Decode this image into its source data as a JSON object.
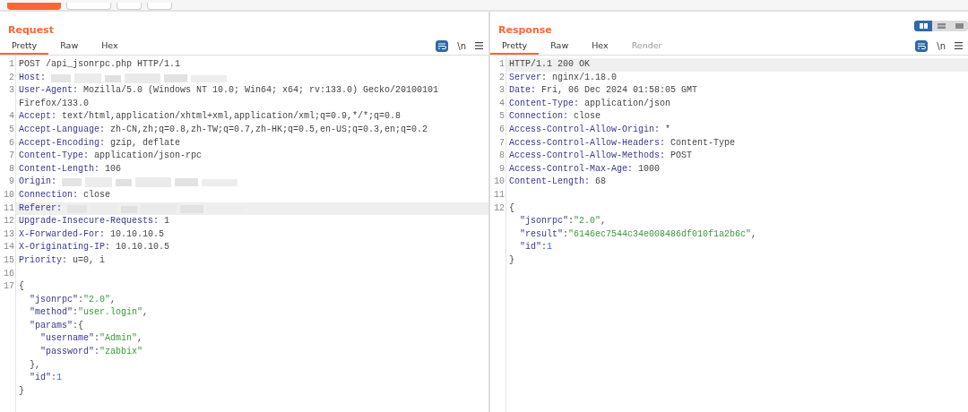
{
  "toolbar": {
    "buttons": [
      {
        "kind": "primary"
      },
      {
        "kind": "plain"
      },
      {
        "kind": "plain"
      },
      {
        "kind": "plain"
      }
    ]
  },
  "panes": [
    {
      "title": "Request",
      "tabs": [
        {
          "label": "Pretty",
          "selected": true,
          "disabled": false
        },
        {
          "label": "Raw",
          "selected": false,
          "disabled": false
        },
        {
          "label": "Hex",
          "selected": false,
          "disabled": false
        }
      ],
      "tools": {
        "wrap_on": true,
        "newline_label": "\\n"
      },
      "lines": [
        {
          "number": "1",
          "highlighted": false,
          "segments": [
            {
              "kind": "plain",
              "text": "POST /api_jsonrpc.php HTTP/1.1"
            }
          ]
        },
        {
          "number": "2",
          "highlighted": false,
          "segments": [
            {
              "kind": "key",
              "text": "Host:"
            },
            {
              "kind": "redacted"
            }
          ]
        },
        {
          "number": "3",
          "highlighted": false,
          "segments": [
            {
              "kind": "key",
              "text": "User-Agent:"
            },
            {
              "kind": "value",
              "text": "Mozilla/5.0 (Windows NT 10.0; Win64; x64; rv:133.0) Gecko/20100101 Firefox/133.0"
            }
          ]
        },
        {
          "number": "4",
          "highlighted": false,
          "segments": [
            {
              "kind": "key",
              "text": "Accept:"
            },
            {
              "kind": "value",
              "text": "text/html,application/xhtml+xml,application/xml;q=0.9,*/*;q=0.8"
            }
          ]
        },
        {
          "number": "5",
          "highlighted": false,
          "segments": [
            {
              "kind": "key",
              "text": "Accept-Language:"
            },
            {
              "kind": "value",
              "text": "zh-CN,zh;q=0.8,zh-TW;q=0.7,zh-HK;q=0.5,en-US;q=0.3,en;q=0.2"
            }
          ]
        },
        {
          "number": "6",
          "highlighted": false,
          "segments": [
            {
              "kind": "key",
              "text": "Accept-Encoding:"
            },
            {
              "kind": "value",
              "text": "gzip, deflate"
            }
          ]
        },
        {
          "number": "7",
          "highlighted": false,
          "segments": [
            {
              "kind": "key",
              "text": "Content-Type:"
            },
            {
              "kind": "value",
              "text": "application/json-rpc"
            }
          ]
        },
        {
          "number": "8",
          "highlighted": false,
          "segments": [
            {
              "kind": "key",
              "text": "Content-Length:"
            },
            {
              "kind": "value",
              "text": "106"
            }
          ]
        },
        {
          "number": "9",
          "highlighted": false,
          "segments": [
            {
              "kind": "key",
              "text": "Origin:"
            },
            {
              "kind": "redacted"
            }
          ]
        },
        {
          "number": "10",
          "highlighted": false,
          "segments": [
            {
              "kind": "key",
              "text": "Connection:"
            },
            {
              "kind": "value",
              "text": "close"
            }
          ]
        },
        {
          "number": "11",
          "highlighted": true,
          "segments": [
            {
              "kind": "key",
              "text": "Referer:"
            },
            {
              "kind": "redacted"
            }
          ]
        },
        {
          "number": "12",
          "highlighted": false,
          "segments": [
            {
              "kind": "key",
              "text": "Upgrade-Insecure-Requests:"
            },
            {
              "kind": "value",
              "text": "1"
            }
          ]
        },
        {
          "number": "13",
          "highlighted": false,
          "segments": [
            {
              "kind": "key",
              "text": "X-Forwarded-For:"
            },
            {
              "kind": "value",
              "text": "10.10.10.5"
            }
          ]
        },
        {
          "number": "14",
          "highlighted": false,
          "segments": [
            {
              "kind": "key",
              "text": "X-Originating-IP:"
            },
            {
              "kind": "value",
              "text": "10.10.10.5"
            }
          ]
        },
        {
          "number": "15",
          "highlighted": false,
          "segments": [
            {
              "kind": "key",
              "text": "Priority:"
            },
            {
              "kind": "value",
              "text": "u=0, i"
            }
          ]
        },
        {
          "number": "16",
          "highlighted": false
        },
        {
          "number": "17",
          "highlighted": false,
          "segments": [
            {
              "kind": "punct",
              "text": "{"
            }
          ]
        },
        {
          "highlighted": false,
          "segments": [
            {
              "kind": "jkey",
              "text": "  \"jsonrpc\""
            },
            {
              "kind": "punct",
              "text": ":"
            },
            {
              "kind": "string",
              "text": "\"2.0\""
            },
            {
              "kind": "punct",
              "text": ","
            }
          ]
        },
        {
          "highlighted": false,
          "segments": [
            {
              "kind": "jkey",
              "text": "  \"method\""
            },
            {
              "kind": "punct",
              "text": ":"
            },
            {
              "kind": "string",
              "text": "\"user.login\""
            },
            {
              "kind": "punct",
              "text": ","
            }
          ]
        },
        {
          "highlighted": false,
          "segments": [
            {
              "kind": "jkey",
              "text": "  \"params\""
            },
            {
              "kind": "punct",
              "text": ":{"
            }
          ]
        },
        {
          "highlighted": false,
          "segments": [
            {
              "kind": "jkey",
              "text": "    \"username\""
            },
            {
              "kind": "punct",
              "text": ":"
            },
            {
              "kind": "string",
              "text": "\"Admin\""
            },
            {
              "kind": "punct",
              "text": ","
            }
          ]
        },
        {
          "highlighted": false,
          "segments": [
            {
              "kind": "jkey",
              "text": "    \"password\""
            },
            {
              "kind": "punct",
              "text": ":"
            },
            {
              "kind": "string",
              "text": "\"zabbix\""
            }
          ]
        },
        {
          "highlighted": false,
          "segments": [
            {
              "kind": "punct",
              "text": "  },"
            }
          ]
        },
        {
          "highlighted": false,
          "segments": [
            {
              "kind": "jkey",
              "text": "  \"id\""
            },
            {
              "kind": "punct",
              "text": ":"
            },
            {
              "kind": "number",
              "text": "1"
            }
          ]
        },
        {
          "highlighted": false,
          "segments": [
            {
              "kind": "punct",
              "text": "}"
            }
          ]
        }
      ]
    },
    {
      "title": "Response",
      "layout_toggle": [
        {
          "kind": "side",
          "selected": true
        },
        {
          "kind": "stacked",
          "selected": false
        },
        {
          "kind": "single",
          "selected": false
        }
      ],
      "tabs": [
        {
          "label": "Pretty",
          "selected": true,
          "disabled": false
        },
        {
          "label": "Raw",
          "selected": false,
          "disabled": false
        },
        {
          "label": "Hex",
          "selected": false,
          "disabled": false
        },
        {
          "label": "Render",
          "selected": false,
          "disabled": true
        }
      ],
      "tools": {
        "wrap_on": true,
        "newline_label": "\\n"
      },
      "lines": [
        {
          "number": "1",
          "highlighted": true,
          "segments": [
            {
              "kind": "plain",
              "text": "HTTP/1.1 200 OK"
            }
          ]
        },
        {
          "number": "2",
          "highlighted": false,
          "segments": [
            {
              "kind": "key",
              "text": "Server:"
            },
            {
              "kind": "value",
              "text": "nginx/1.18.0"
            }
          ]
        },
        {
          "number": "3",
          "highlighted": false,
          "segments": [
            {
              "kind": "key",
              "text": "Date:"
            },
            {
              "kind": "value",
              "text": "Fri, 06 Dec 2024 01:58:05 GMT"
            }
          ]
        },
        {
          "number": "4",
          "highlighted": false,
          "segments": [
            {
              "kind": "key",
              "text": "Content-Type:"
            },
            {
              "kind": "value",
              "text": "application/json"
            }
          ]
        },
        {
          "number": "5",
          "highlighted": false,
          "segments": [
            {
              "kind": "key",
              "text": "Connection:"
            },
            {
              "kind": "value",
              "text": "close"
            }
          ]
        },
        {
          "number": "6",
          "highlighted": false,
          "segments": [
            {
              "kind": "key",
              "text": "Access-Control-Allow-Origin:"
            },
            {
              "kind": "value",
              "text": "*"
            }
          ]
        },
        {
          "number": "7",
          "highlighted": false,
          "segments": [
            {
              "kind": "key",
              "text": "Access-Control-Allow-Headers:"
            },
            {
              "kind": "value",
              "text": "Content-Type"
            }
          ]
        },
        {
          "number": "8",
          "highlighted": false,
          "segments": [
            {
              "kind": "key",
              "text": "Access-Control-Allow-Methods:"
            },
            {
              "kind": "value",
              "text": "POST"
            }
          ]
        },
        {
          "number": "9",
          "highlighted": false,
          "segments": [
            {
              "kind": "key",
              "text": "Access-Control-Max-Age:"
            },
            {
              "kind": "value",
              "text": "1000"
            }
          ]
        },
        {
          "number": "10",
          "highlighted": false,
          "segments": [
            {
              "kind": "key",
              "text": "Content-Length:"
            },
            {
              "kind": "value",
              "text": "68"
            }
          ]
        },
        {
          "number": "11",
          "highlighted": false
        },
        {
          "number": "12",
          "highlighted": false,
          "segments": [
            {
              "kind": "punct",
              "text": "{"
            }
          ]
        },
        {
          "highlighted": false,
          "segments": [
            {
              "kind": "jkey",
              "text": "  \"jsonrpc\""
            },
            {
              "kind": "punct",
              "text": ":"
            },
            {
              "kind": "string",
              "text": "\"2.0\""
            },
            {
              "kind": "punct",
              "text": ","
            }
          ]
        },
        {
          "highlighted": false,
          "segments": [
            {
              "kind": "jkey",
              "text": "  \"result\""
            },
            {
              "kind": "punct",
              "text": ":"
            },
            {
              "kind": "string",
              "text": "\"6146ec7544c34e008486df010f1a2b6c\""
            },
            {
              "kind": "punct",
              "text": ","
            }
          ]
        },
        {
          "highlighted": false,
          "segments": [
            {
              "kind": "jkey",
              "text": "  \"id\""
            },
            {
              "kind": "punct",
              "text": ":"
            },
            {
              "kind": "number",
              "text": "1"
            }
          ]
        },
        {
          "highlighted": false,
          "segments": [
            {
              "kind": "punct",
              "text": "}"
            }
          ]
        }
      ]
    }
  ]
}
